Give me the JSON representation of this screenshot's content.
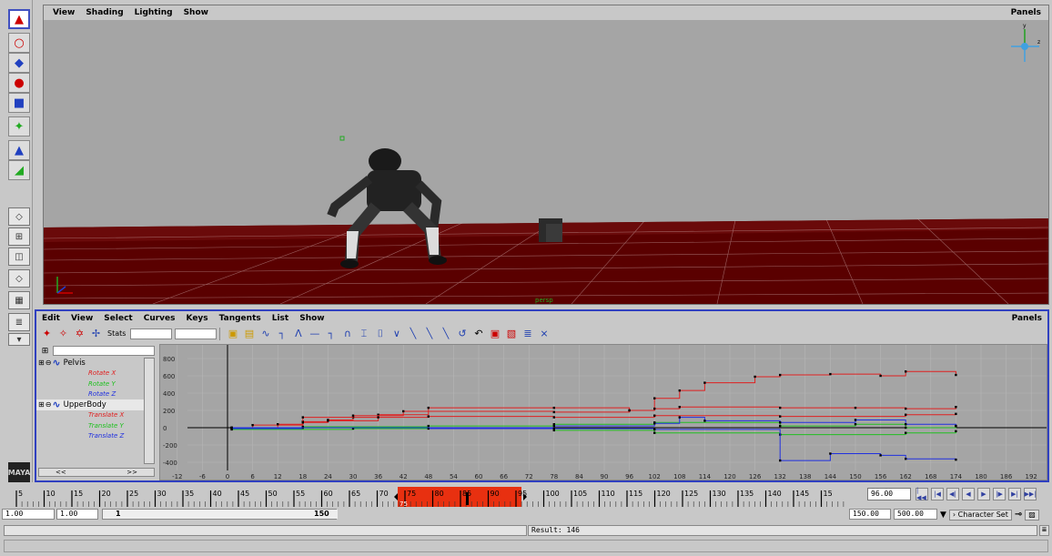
{
  "viewport": {
    "menus": [
      "View",
      "Shading",
      "Lighting",
      "Show"
    ],
    "panels_label": "Panels",
    "gizmo_y": "y",
    "gizmo_z": "z"
  },
  "graph_editor": {
    "menus": [
      "Edit",
      "View",
      "Select",
      "Curves",
      "Keys",
      "Tangents",
      "List",
      "Show"
    ],
    "panels_label": "Panels",
    "stats_label": "Stats",
    "outliner": {
      "nodes": [
        {
          "name": "Pelvis",
          "attrs": [
            "Rotate X",
            "Rotate Y",
            "Rotate Z"
          ]
        },
        {
          "name": "UpperBody",
          "attrs": [
            "Translate X",
            "Translate Y",
            "Translate Z"
          ]
        }
      ],
      "scroll_left": "<<",
      "scroll_right": ">>"
    },
    "graph": {
      "y_ticks": [
        "800",
        "600",
        "400",
        "200",
        "0",
        "-200",
        "-400"
      ],
      "x_ticks": [
        "-12",
        "-6",
        "0",
        "6",
        "12",
        "18",
        "24",
        "30",
        "36",
        "42",
        "48",
        "54",
        "60",
        "66",
        "72",
        "78",
        "84",
        "90",
        "96",
        "102",
        "108",
        "114",
        "120",
        "126",
        "132",
        "138",
        "144",
        "150",
        "156",
        "162",
        "168",
        "174",
        "180",
        "186",
        "192"
      ]
    }
  },
  "timeline": {
    "labels": [
      "5",
      "10",
      "15",
      "20",
      "25",
      "30",
      "35",
      "40",
      "45",
      "50",
      "55",
      "60",
      "65",
      "70",
      "75",
      "80",
      "85",
      "90",
      "95",
      "100",
      "105",
      "110",
      "115",
      "120",
      "125",
      "130",
      "135",
      "140",
      "145",
      "15"
    ],
    "range_start_label": "75",
    "current_frame": "96.00"
  },
  "range": {
    "start": "1.00",
    "playback_start": "1.00",
    "slider_start": "1",
    "slider_end": "150",
    "playback_end": "150.00",
    "end": "500.00",
    "character_set": "Character Set"
  },
  "command": {
    "result": "Result: 146"
  },
  "colors": {
    "rotate_x": "#e02020",
    "rotate_y": "#20c020",
    "rotate_z": "#2030e0",
    "selection_range": "#e83010"
  }
}
